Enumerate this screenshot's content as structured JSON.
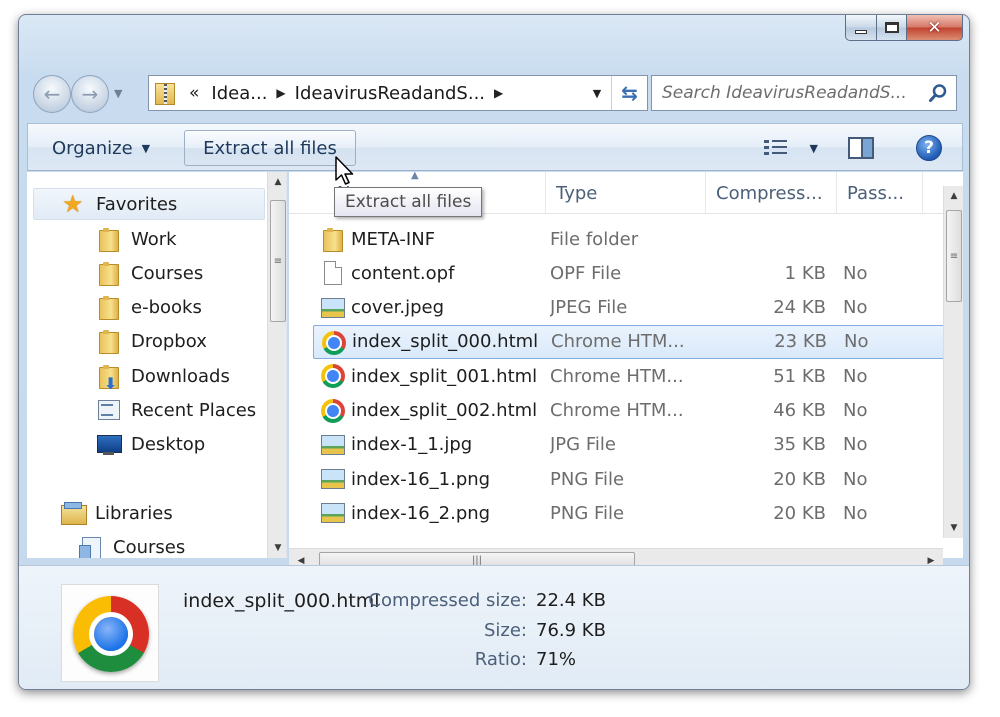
{
  "window": {
    "caption_buttons": {
      "minimize_icon": "minimize-icon",
      "maximize_icon": "maximize-icon",
      "close_label": "✕"
    }
  },
  "address": {
    "overflow": "«",
    "crumbs": [
      "Idea...",
      "IdeavirusReadandS..."
    ],
    "folder_icon": "zip-folder-icon"
  },
  "search": {
    "placeholder": "Search IdeavirusReadandS..."
  },
  "toolbar": {
    "organize_label": "Organize",
    "extract_label": "Extract all files",
    "help_label": "?"
  },
  "nav_pane": {
    "favorites_label": "Favorites",
    "items": [
      "Work",
      "Courses",
      "e-books",
      "Dropbox",
      "Downloads",
      "Recent Places",
      "Desktop"
    ],
    "libraries_label": "Libraries",
    "library_items": [
      "Courses"
    ]
  },
  "columns": {
    "name": "Name",
    "type": "Type",
    "compressed": "Compress...",
    "password": "Pass..."
  },
  "files": [
    {
      "name": "META-INF",
      "type": "File folder",
      "size": "",
      "password": "",
      "icon": "folder-icon"
    },
    {
      "name": "content.opf",
      "type": "OPF File",
      "size": "1 KB",
      "password": "No",
      "icon": "document-icon"
    },
    {
      "name": "cover.jpeg",
      "type": "JPEG File",
      "size": "24 KB",
      "password": "No",
      "icon": "image-icon"
    },
    {
      "name": "index_split_000.html",
      "type": "Chrome HTM...",
      "size": "23 KB",
      "password": "No",
      "icon": "chrome-icon",
      "selected": true
    },
    {
      "name": "index_split_001.html",
      "type": "Chrome HTM...",
      "size": "51 KB",
      "password": "No",
      "icon": "chrome-icon"
    },
    {
      "name": "index_split_002.html",
      "type": "Chrome HTM...",
      "size": "46 KB",
      "password": "No",
      "icon": "chrome-icon"
    },
    {
      "name": "index-1_1.jpg",
      "type": "JPG File",
      "size": "35 KB",
      "password": "No",
      "icon": "image-icon"
    },
    {
      "name": "index-16_1.png",
      "type": "PNG File",
      "size": "20 KB",
      "password": "No",
      "icon": "image-icon"
    },
    {
      "name": "index-16_2.png",
      "type": "PNG File",
      "size": "20 KB",
      "password": "No",
      "icon": "image-icon"
    }
  ],
  "details": {
    "file_name": "index_split_000.html",
    "compressed_label": "Compressed size:",
    "compressed_value": "22.4 KB",
    "size_label": "Size:",
    "size_value": "76.9 KB",
    "ratio_label": "Ratio:",
    "ratio_value": "71%"
  },
  "tooltip": {
    "text": "Extract all files"
  }
}
